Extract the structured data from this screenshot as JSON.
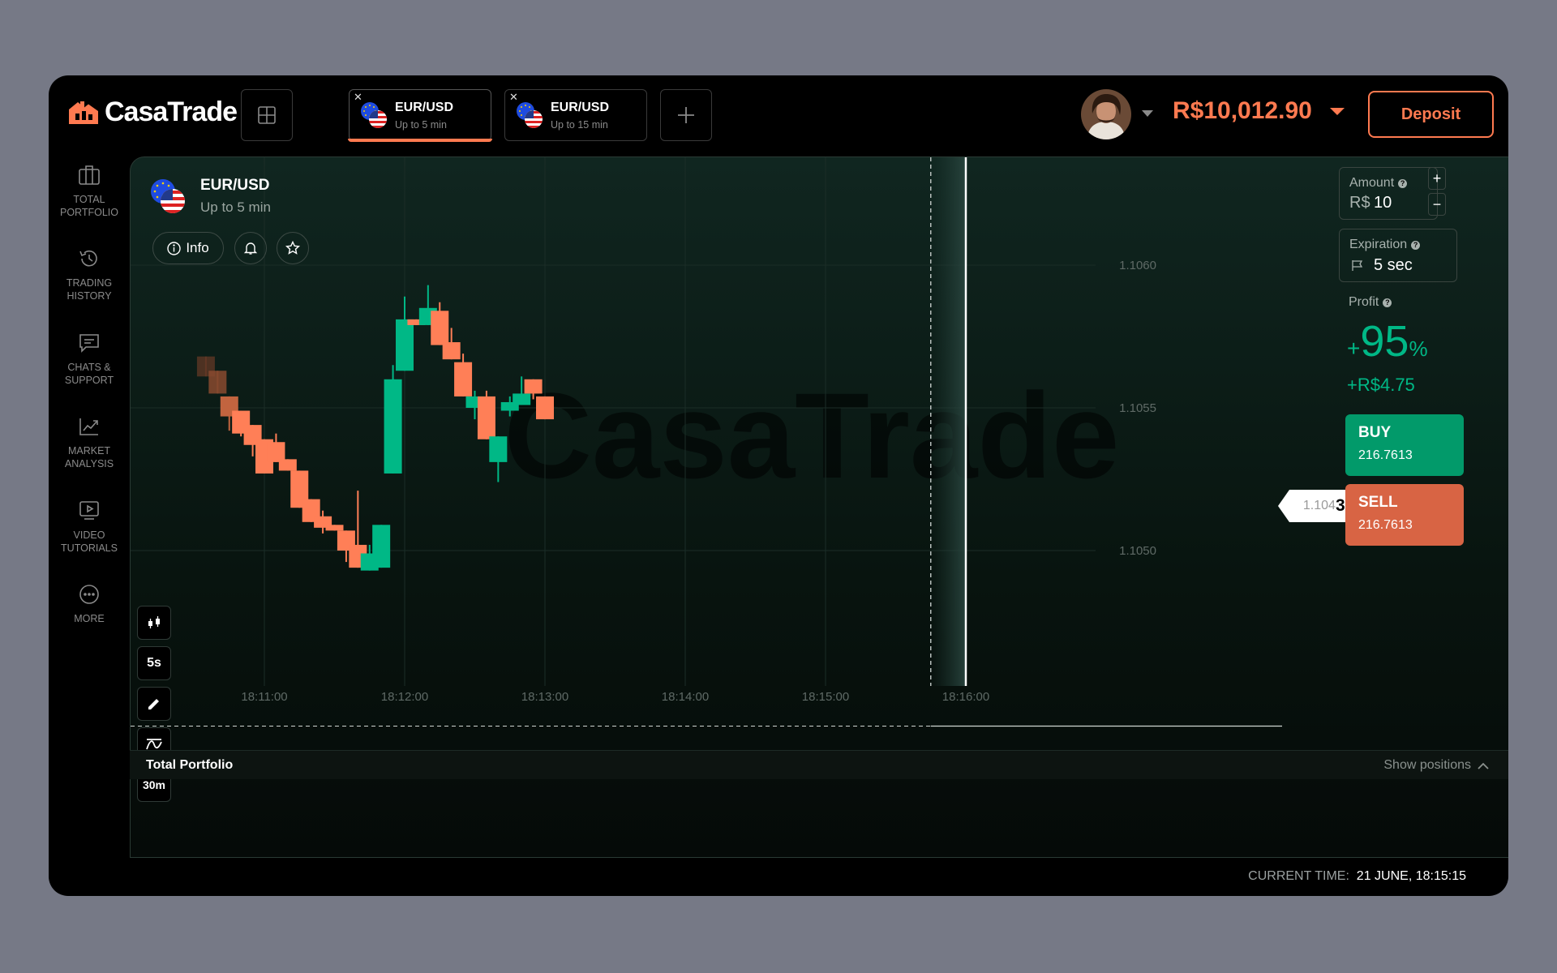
{
  "brand": {
    "name": "CasaTrade",
    "watermark": "CasaTrade"
  },
  "tabs": [
    {
      "name": "EUR/USD",
      "sub": "Up to 5 min",
      "active": true,
      "close": "✕"
    },
    {
      "name": "EUR/USD",
      "sub": "Up to 15 min",
      "active": false,
      "close": "✕"
    }
  ],
  "account": {
    "balance": "R$10,012.90",
    "deposit_label": "Deposit"
  },
  "sidebar": [
    {
      "label": "TOTAL\nPORTFOLIO",
      "icon": "briefcase-icon"
    },
    {
      "label": "TRADING\nHISTORY",
      "icon": "history-icon"
    },
    {
      "label": "CHATS &\nSUPPORT",
      "icon": "chat-icon"
    },
    {
      "label": "MARKET\nANALYSIS",
      "icon": "chart-line-icon"
    },
    {
      "label": "VIDEO\nTUTORIALS",
      "icon": "video-icon"
    },
    {
      "label": "MORE",
      "icon": "more-icon"
    }
  ],
  "asset": {
    "name": "EUR/USD",
    "sub": "Up to 5 min",
    "info_label": "Info"
  },
  "tools": {
    "timeframe": "5s",
    "range": "30m"
  },
  "trade": {
    "amount_label": "Amount",
    "amount_currency": "R$",
    "amount_value": "10",
    "plus": "+",
    "minus": "−",
    "expiration_label": "Expiration",
    "expiration_value": "5 sec",
    "profit_label": "Profit",
    "profit_sign": "+",
    "profit_pct": "95",
    "profit_pct_sym": "%",
    "profit_amount": "+R$4.75",
    "buy_label": "BUY",
    "buy_value": "216.7613",
    "sell_label": "SELL",
    "sell_value": "216.7613"
  },
  "price_tag": {
    "dim": "1.104",
    "bold": "385"
  },
  "footer": {
    "portfolio_label": "Total Portfolio",
    "show_positions": "Show positions",
    "current_time_label": "CURRENT TIME:",
    "current_time_value": "21 JUNE, 18:15:15"
  },
  "colors": {
    "up": "#00b886",
    "down": "#ff7f57",
    "accent": "#ff7a50"
  },
  "chart_data": {
    "type": "candlestick",
    "y_ticks": [
      1.106,
      1.1055,
      1.105
    ],
    "y_tick_labels": [
      "1.1060",
      "1.1055",
      "1.1050"
    ],
    "x_tick_labels": [
      "18:11:00",
      "18:12:00",
      "18:13:00",
      "18:14:00",
      "18:15:00",
      "18:16:00"
    ],
    "current_price": 1.104385,
    "current_time": "18:15:15",
    "expiry_time": "18:15:45",
    "candles": [
      {
        "t": "18:10:35",
        "o": 1.10568,
        "c": 1.10561,
        "h": 1.10568,
        "l": 1.10561
      },
      {
        "t": "18:10:40",
        "o": 1.10563,
        "c": 1.10555,
        "h": 1.10563,
        "l": 1.10555
      },
      {
        "t": "18:10:45",
        "o": 1.10554,
        "c": 1.10547,
        "h": 1.10554,
        "l": 1.10542
      },
      {
        "t": "18:10:50",
        "o": 1.10549,
        "c": 1.10541,
        "h": 1.10549,
        "l": 1.1054
      },
      {
        "t": "18:10:55",
        "o": 1.10544,
        "c": 1.10537,
        "h": 1.10544,
        "l": 1.10533
      },
      {
        "t": "18:11:00",
        "o": 1.10539,
        "c": 1.10527,
        "h": 1.10539,
        "l": 1.10527
      },
      {
        "t": "18:11:05",
        "o": 1.10538,
        "c": 1.10531,
        "h": 1.10541,
        "l": 1.10531
      },
      {
        "t": "18:11:10",
        "o": 1.10532,
        "c": 1.10528,
        "h": 1.10532,
        "l": 1.10528
      },
      {
        "t": "18:11:15",
        "o": 1.10528,
        "c": 1.10515,
        "h": 1.10528,
        "l": 1.10515
      },
      {
        "t": "18:11:20",
        "o": 1.10518,
        "c": 1.1051,
        "h": 1.10518,
        "l": 1.1051
      },
      {
        "t": "18:11:25",
        "o": 1.10512,
        "c": 1.10508,
        "h": 1.10514,
        "l": 1.10506
      },
      {
        "t": "18:11:30",
        "o": 1.10509,
        "c": 1.10507,
        "h": 1.10509,
        "l": 1.10507
      },
      {
        "t": "18:11:35",
        "o": 1.10507,
        "c": 1.105,
        "h": 1.10507,
        "l": 1.10496
      },
      {
        "t": "18:11:40",
        "o": 1.10502,
        "c": 1.10494,
        "h": 1.10521,
        "l": 1.10494
      },
      {
        "t": "18:11:45",
        "o": 1.10493,
        "c": 1.10499,
        "h": 1.10502,
        "l": 1.10493
      },
      {
        "t": "18:11:50",
        "o": 1.10494,
        "c": 1.10509,
        "h": 1.10509,
        "l": 1.10494
      },
      {
        "t": "18:11:55",
        "o": 1.10527,
        "c": 1.1056,
        "h": 1.10565,
        "l": 1.10527
      },
      {
        "t": "18:12:00",
        "o": 1.10563,
        "c": 1.10581,
        "h": 1.10589,
        "l": 1.10563
      },
      {
        "t": "18:12:05",
        "o": 1.10581,
        "c": 1.10579,
        "h": 1.10581,
        "l": 1.10579
      },
      {
        "t": "18:12:10",
        "o": 1.10579,
        "c": 1.10585,
        "h": 1.10593,
        "l": 1.10579
      },
      {
        "t": "18:12:15",
        "o": 1.10584,
        "c": 1.10572,
        "h": 1.10587,
        "l": 1.10572
      },
      {
        "t": "18:12:20",
        "o": 1.10573,
        "c": 1.10567,
        "h": 1.10578,
        "l": 1.10567
      },
      {
        "t": "18:12:25",
        "o": 1.10566,
        "c": 1.10554,
        "h": 1.10569,
        "l": 1.10554
      },
      {
        "t": "18:12:30",
        "o": 1.1055,
        "c": 1.10554,
        "h": 1.10556,
        "l": 1.10546
      },
      {
        "t": "18:12:35",
        "o": 1.10554,
        "c": 1.10539,
        "h": 1.10556,
        "l": 1.10539
      },
      {
        "t": "18:12:40",
        "o": 1.10531,
        "c": 1.1054,
        "h": 1.1054,
        "l": 1.10524
      },
      {
        "t": "18:12:45",
        "o": 1.10549,
        "c": 1.10552,
        "h": 1.10554,
        "l": 1.10547
      },
      {
        "t": "18:12:50",
        "o": 1.10551,
        "c": 1.10555,
        "h": 1.10561,
        "l": 1.10551
      },
      {
        "t": "18:12:55",
        "o": 1.1056,
        "c": 1.10555,
        "h": 1.1056,
        "l": 1.10553
      },
      {
        "t": "18:13:00",
        "o": 1.10554,
        "c": 1.10546,
        "h": 1.10554,
        "l": 1.10546
      }
    ]
  }
}
